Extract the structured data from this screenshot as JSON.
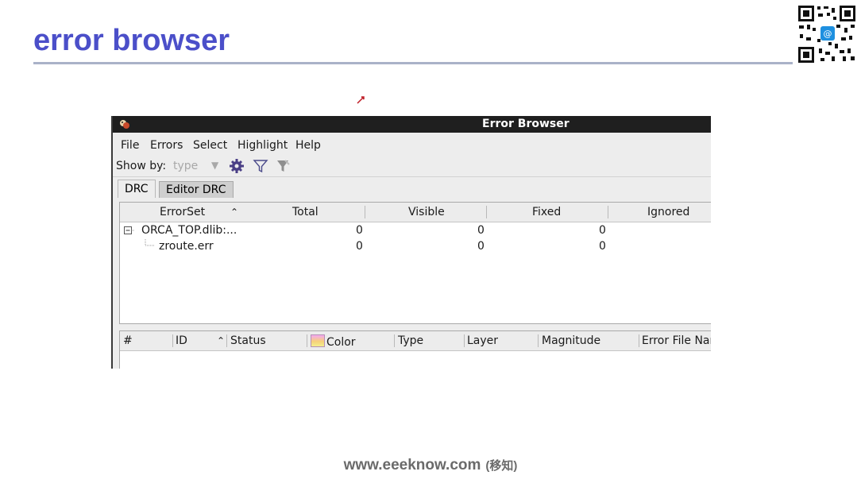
{
  "slide": {
    "title": "error browser",
    "footer_main": "www.eeeknow.com",
    "footer_note": "(移知)"
  },
  "window": {
    "title": "Error Browser",
    "menu": [
      "File",
      "Errors",
      "Select",
      "Highlight",
      "Help"
    ],
    "toolbar": {
      "show_by_label": "Show by:",
      "show_by_value": "type",
      "icons": [
        "settings-gear-icon",
        "filter-icon",
        "clear-filter-icon"
      ]
    },
    "tabs": [
      {
        "label": "DRC",
        "active": true
      },
      {
        "label": "Editor DRC",
        "active": false
      }
    ],
    "errorset_table": {
      "columns": [
        "ErrorSet",
        "Total",
        "Visible",
        "Fixed",
        "Ignored"
      ],
      "rows": [
        {
          "name": "ORCA_TOP.dlib:...",
          "total": "0",
          "visible": "0",
          "fixed": "0",
          "expanded": true
        },
        {
          "name": "zroute.err",
          "total": "0",
          "visible": "0",
          "fixed": "0"
        }
      ]
    },
    "error_table": {
      "columns": [
        "#",
        "ID",
        "Status",
        "Color",
        "Type",
        "Layer",
        "Magnitude",
        "Error File Nar"
      ]
    }
  },
  "colors": {
    "title_blue": "#4b4fc9",
    "window_titlebar": "#1f1f1f",
    "rule": "#aab2c8"
  }
}
